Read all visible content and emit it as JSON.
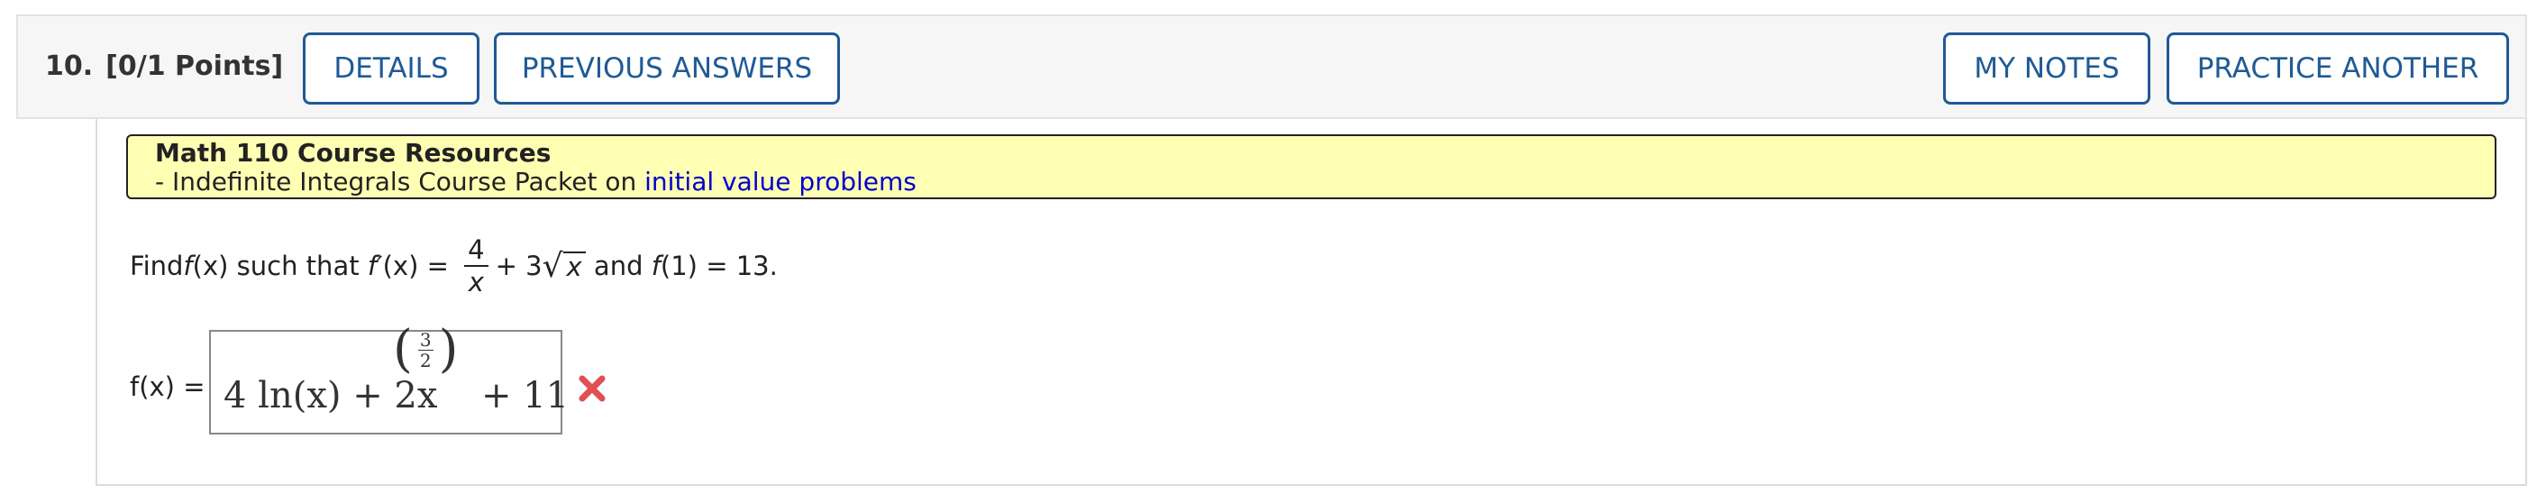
{
  "question": {
    "number": "10.",
    "points": "[0/1 Points]"
  },
  "buttons": {
    "details": "DETAILS",
    "previous_answers": "PREVIOUS ANSWERS",
    "my_notes": "MY NOTES",
    "practice_another": "PRACTICE ANOTHER"
  },
  "resources": {
    "title": "Math 110 Course Resources",
    "line_prefix": "- Indefinite Integrals Course Packet on ",
    "link_text": "initial value problems"
  },
  "problem": {
    "find": "Find ",
    "f": "f",
    "x_paren": "(x)",
    "such_that": " such that ",
    "fprime": "f′",
    "equals": " = ",
    "frac_num": "4",
    "frac_den": "x",
    "plus_three": "+ 3",
    "sqrt_arg": "x",
    "and_text": " and ",
    "condition": "(1) = 13."
  },
  "answer": {
    "label": "f(x) = ",
    "expr_main": "4 ln(x) + 2x",
    "exp_num": "3",
    "exp_den": "2",
    "expr_tail": "+ 11",
    "status": "incorrect",
    "status_icon": "x-mark-icon",
    "status_color": "#e05050"
  },
  "colors": {
    "button_blue": "#1f5a96",
    "resource_bg": "#ffffb4",
    "link_blue": "#0000cc"
  }
}
